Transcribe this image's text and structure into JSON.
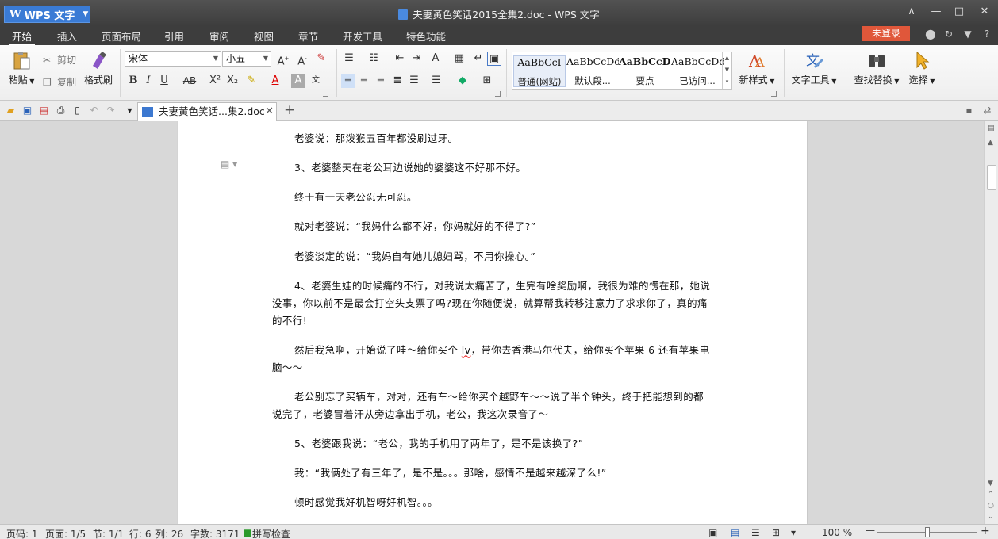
{
  "window": {
    "app_button": "WPS 文字",
    "title": "夫妻黃色笑话2015全集2.doc - WPS 文字",
    "min": "—",
    "max": "□",
    "close": "✕",
    "ribbon_toggle": "∧"
  },
  "tabs": [
    "开始",
    "插入",
    "页面布局",
    "引用",
    "审阅",
    "视图",
    "章节",
    "开发工具",
    "特色功能"
  ],
  "login": "未登录",
  "help": "?",
  "ribbon": {
    "paste": "粘贴",
    "cut": "剪切",
    "copy": "复制",
    "format_painter": "格式刷",
    "font_name": "宋体",
    "font_size": "小五",
    "styles": [
      {
        "preview": "AaBbCcI",
        "name": "普通(网站)"
      },
      {
        "preview": "AaBbCcDd",
        "name": "默认段..."
      },
      {
        "preview": "AaBbCcDd",
        "name": "要点"
      },
      {
        "preview": "AaBbCcDd",
        "name": "已访问..."
      }
    ],
    "new_style": "新样式",
    "text_tools": "文字工具",
    "find_replace": "查找替换",
    "select": "选择"
  },
  "doc_tab": {
    "label": "夫妻黃色笑话...集2.doc",
    "close": "✕"
  },
  "document": {
    "paragraphs": [
      {
        "text": "老婆说：那泼猴五百年都没刷过牙。"
      },
      {
        "text": "3、老婆整天在老公耳边说她的婆婆这不好那不好。"
      },
      {
        "text": "终于有一天老公忍无可忍。"
      },
      {
        "text": "就对老婆说：“我妈什么都不好，你妈就好的不得了?”"
      },
      {
        "text": "老婆淡定的说：“我妈自有她儿媳妇骂，不用你操心。”"
      },
      {
        "text": "4、老婆生娃的时候痛的不行，对我说太痛苦了，生完有啥奖励啊，我很为难的愣在那，她说没事，你以前不是最会打空头支票了吗?现在你随便说，就算帮我转移注意力了求求你了，真的痛的不行!"
      },
      {
        "text_a": "然后我急啊，开始说了哇～给你买个 ",
        "squiggle": "lv",
        "text_b": "，带你去香港马尔代夫，给你买个苹果 6 还有苹果电脑～～"
      },
      {
        "text": "老公别忘了买辆车，对对，还有车～给你买个越野车～～说了半个钟头，终于把能想到的都说完了，老婆冒着汗从旁边拿出手机，老公，我这次录音了～"
      },
      {
        "text": "5、老婆跟我说：“老公，我的手机用了两年了，是不是该换了?”"
      },
      {
        "text": "我：“我俩处了有三年了，是不是。。。那啥，感情不是越来越深了么!”"
      },
      {
        "text": "顿时感觉我好机智呀好机智。。。"
      }
    ]
  },
  "status": {
    "page_no": "页码: 1",
    "page": "页面: 1/5",
    "section": "节: 1/1",
    "row": "行: 6",
    "col": "列: 26",
    "words": "字数: 3171",
    "spell": "拼写检查",
    "zoom": "100 %",
    "zoom_minus": "—",
    "zoom_plus": "+"
  },
  "zoom_level_fraction": 0.5,
  "colors": {
    "accent": "#3a7bd5",
    "login": "#e0573a",
    "titlebar": "#444444"
  }
}
